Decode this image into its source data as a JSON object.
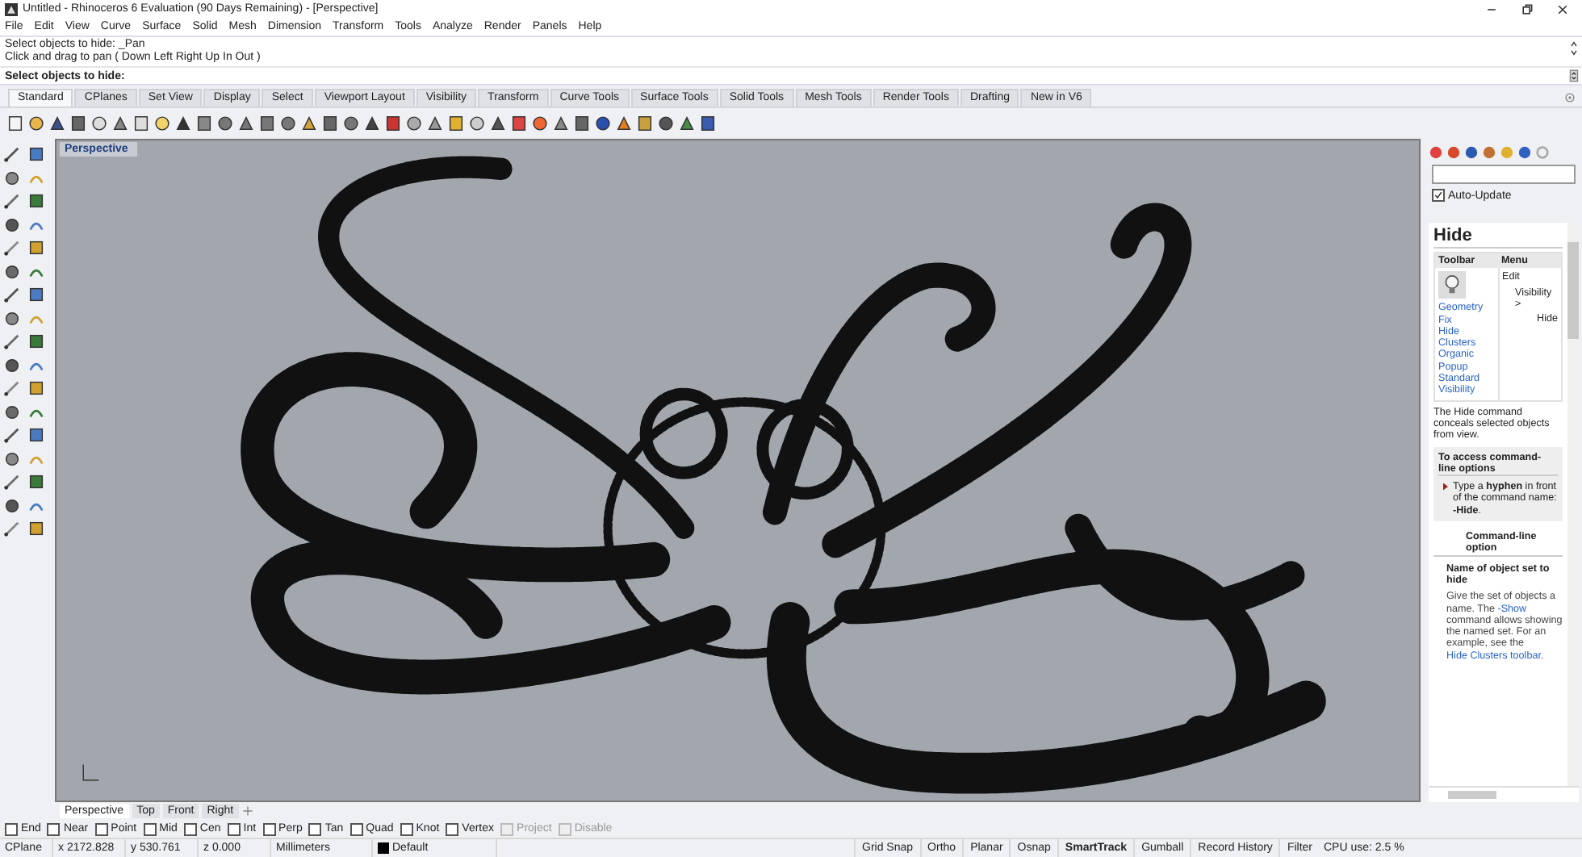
{
  "window": {
    "title": "Untitled - Rhinoceros 6 Evaluation (90 Days Remaining) - [Perspective]"
  },
  "menu": [
    "File",
    "Edit",
    "View",
    "Curve",
    "Surface",
    "Solid",
    "Mesh",
    "Dimension",
    "Transform",
    "Tools",
    "Analyze",
    "Render",
    "Panels",
    "Help"
  ],
  "command_history": [
    "Select objects to hide: _Pan",
    "Click and drag to pan ( Down  Left  Right  Up  In  Out )"
  ],
  "command_prompt": "Select objects to hide:",
  "toolbar_tabs": [
    {
      "label": "Standard",
      "selected": true
    },
    {
      "label": "CPlanes",
      "selected": false
    },
    {
      "label": "Set View",
      "selected": false
    },
    {
      "label": "Display",
      "selected": false
    },
    {
      "label": "Select",
      "selected": false
    },
    {
      "label": "Viewport Layout",
      "selected": false
    },
    {
      "label": "Visibility",
      "selected": false
    },
    {
      "label": "Transform",
      "selected": false
    },
    {
      "label": "Curve Tools",
      "selected": false
    },
    {
      "label": "Surface Tools",
      "selected": false
    },
    {
      "label": "Solid Tools",
      "selected": false
    },
    {
      "label": "Mesh Tools",
      "selected": false
    },
    {
      "label": "Render Tools",
      "selected": false
    },
    {
      "label": "Drafting",
      "selected": false
    },
    {
      "label": "New in V6",
      "selected": false
    }
  ],
  "viewport": {
    "label": "Perspective"
  },
  "viewport_tabs": [
    {
      "label": "Perspective",
      "selected": true
    },
    {
      "label": "Top",
      "selected": false
    },
    {
      "label": "Front",
      "selected": false
    },
    {
      "label": "Right",
      "selected": false
    }
  ],
  "osnaps": [
    {
      "label": "End",
      "checked": false,
      "disabled": false
    },
    {
      "label": "Near",
      "checked": false,
      "disabled": false
    },
    {
      "label": "Point",
      "checked": false,
      "disabled": false
    },
    {
      "label": "Mid",
      "checked": false,
      "disabled": false
    },
    {
      "label": "Cen",
      "checked": false,
      "disabled": false
    },
    {
      "label": "Int",
      "checked": false,
      "disabled": false
    },
    {
      "label": "Perp",
      "checked": false,
      "disabled": false
    },
    {
      "label": "Tan",
      "checked": false,
      "disabled": false
    },
    {
      "label": "Quad",
      "checked": false,
      "disabled": false
    },
    {
      "label": "Knot",
      "checked": false,
      "disabled": false
    },
    {
      "label": "Vertex",
      "checked": false,
      "disabled": false
    },
    {
      "label": "Project",
      "checked": false,
      "disabled": true
    },
    {
      "label": "Disable",
      "checked": false,
      "disabled": true
    }
  ],
  "status_bar": {
    "cplane": "CPlane",
    "x": "x 2172.828",
    "y": "y 530.761",
    "z": "z 0.000",
    "units": "Millimeters",
    "layer": "Default",
    "toggles": [
      {
        "label": "Grid Snap",
        "on": false
      },
      {
        "label": "Ortho",
        "on": false
      },
      {
        "label": "Planar",
        "on": false
      },
      {
        "label": "Osnap",
        "on": false
      },
      {
        "label": "SmartTrack",
        "on": true
      },
      {
        "label": "Gumball",
        "on": false
      },
      {
        "label": "Record History",
        "on": false
      },
      {
        "label": "Filter",
        "on": false
      }
    ],
    "cpu": "CPU use: 2.5 %"
  },
  "panel": {
    "auto_update": {
      "label": "Auto-Update",
      "checked": true
    },
    "help": {
      "title": "Hide",
      "toolbar_header": "Toolbar",
      "menu_header": "Menu",
      "toolbar_links": [
        "Geometry Fix",
        "Hide Clusters",
        "Organic Popup",
        "Standard Visibility"
      ],
      "menu_path": [
        "Edit",
        "Visibility >",
        "Hide"
      ],
      "description": "The Hide command conceals selected objects from view.",
      "box_title": "To access command-line options",
      "box_text": "Type a **hyphen** in front of the command name: **-Hide**.",
      "section": "Command-line option",
      "option_name": "Name of object set to hide",
      "option_text": [
        {
          "text": "Give the set of objects a name. The "
        },
        {
          "link": "-Show"
        },
        {
          "text": " command allows showing the named set. For an example, see the "
        },
        {
          "link": "Hide Clusters toolbar"
        },
        {
          "text": "."
        }
      ]
    }
  }
}
